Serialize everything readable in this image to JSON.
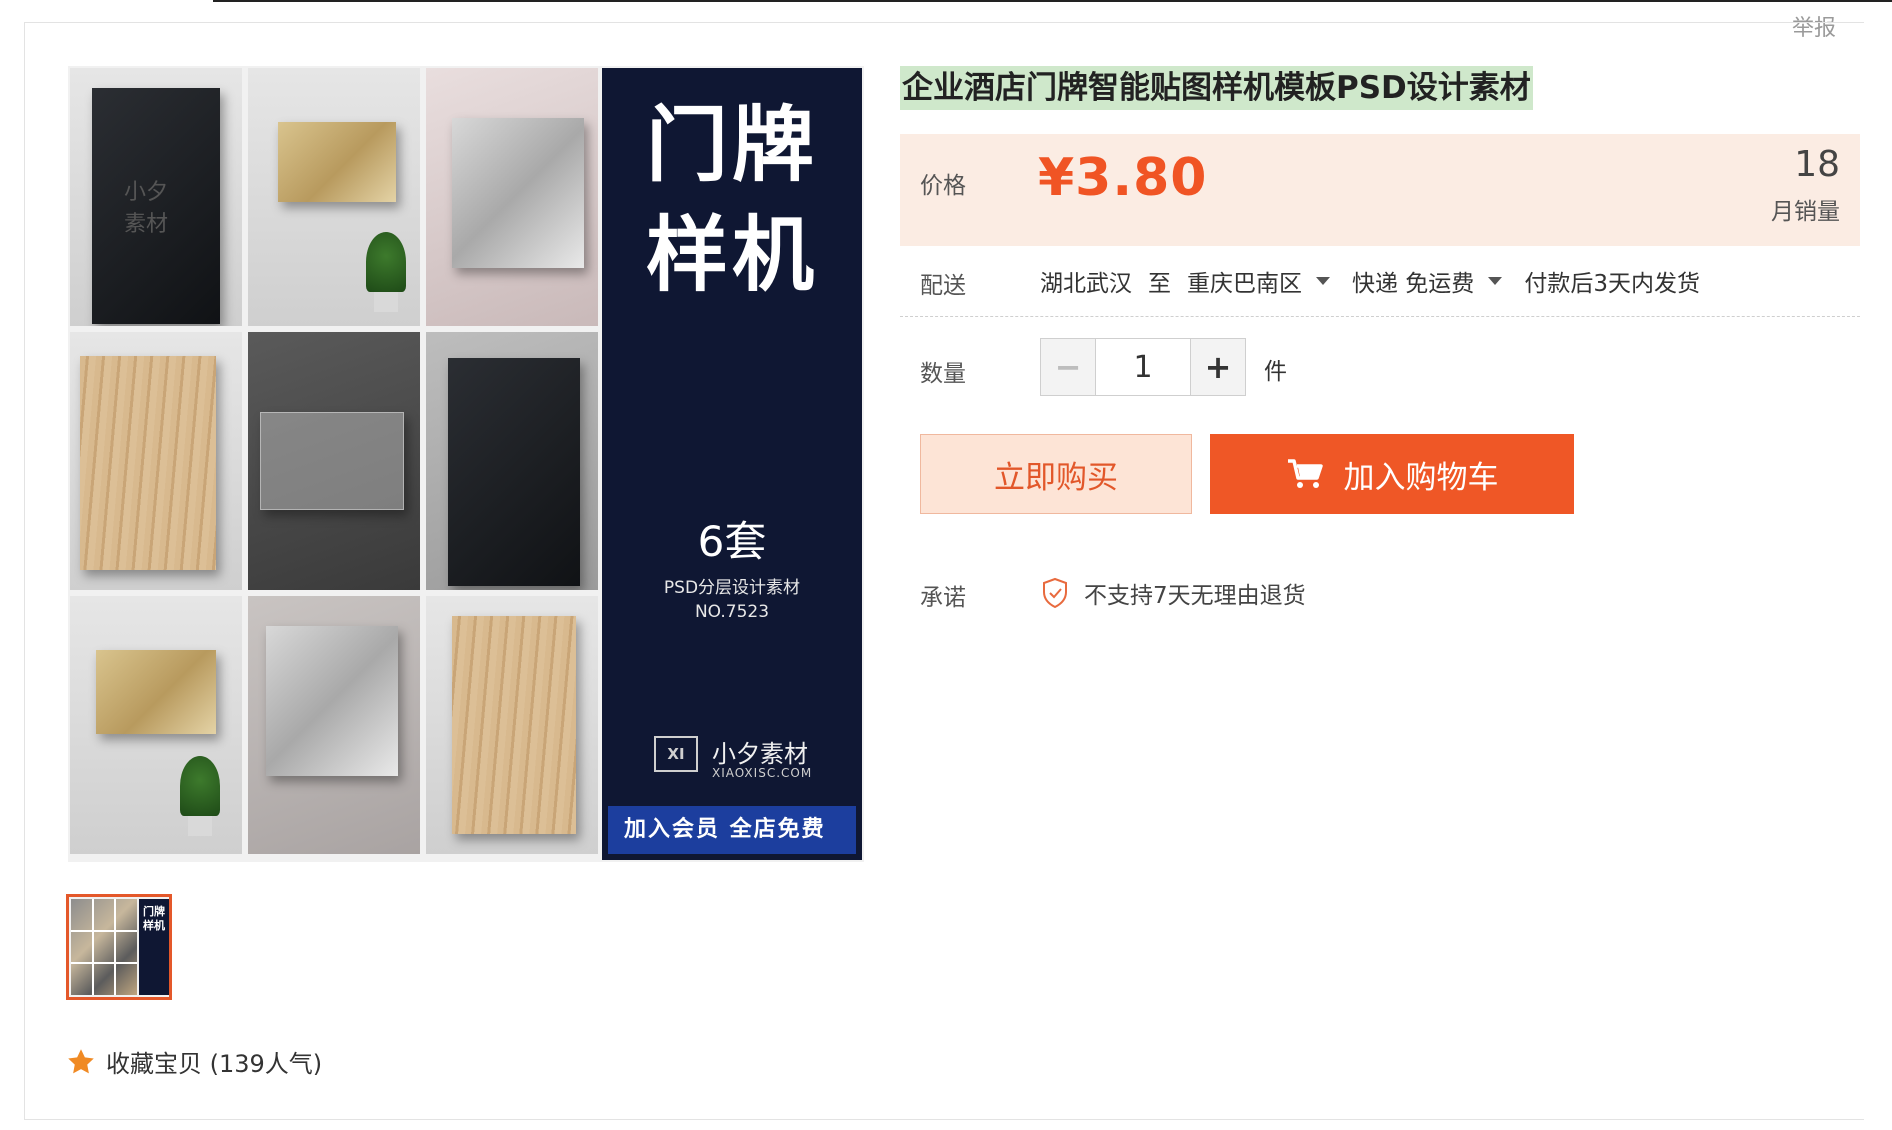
{
  "header": {
    "report_label": "举报"
  },
  "gallery": {
    "promo": {
      "title_line1": "门牌",
      "title_line2": "样机",
      "count": "6套",
      "subtitle": "PSD分层设计素材",
      "number": "NO.7523",
      "brand_mark": "XI",
      "brand_name": "小夕素材",
      "brand_url": "XIAOXISC.COM",
      "banner": "加入会员 全店免费"
    },
    "sign_logo_text": "小夕素材",
    "thumbnail_labels": "门牌\n样机"
  },
  "favorite": {
    "label": "收藏宝贝 (139人气)"
  },
  "product": {
    "title": "企业酒店门牌智能贴图样机模板PSD设计素材",
    "price_label": "价格",
    "price_value": "¥3.80",
    "sales_count": "18",
    "sales_label": "月销量",
    "shipping": {
      "label": "配送",
      "from": "湖北武汉",
      "to_word": "至",
      "destination": "重庆巴南区",
      "method": "快递 免运费",
      "dispatch": "付款后3天内发货"
    },
    "quantity": {
      "label": "数量",
      "value": "1",
      "unit": "件"
    },
    "buttons": {
      "buy_now": "立即购买",
      "add_to_cart": "加入购物车"
    },
    "promise": {
      "label": "承诺",
      "text": "不支持7天无理由退货"
    }
  },
  "colors": {
    "accent": "#ef5726",
    "price": "#f05424",
    "price_bg": "#fbece3",
    "promo_panel": "#0f1733",
    "title_highlight": "#cfe8cb"
  },
  "icons": [
    "zoom-icon",
    "shopping-cart-icon",
    "shield-check-icon",
    "star-icon",
    "caret-down-icon"
  ]
}
